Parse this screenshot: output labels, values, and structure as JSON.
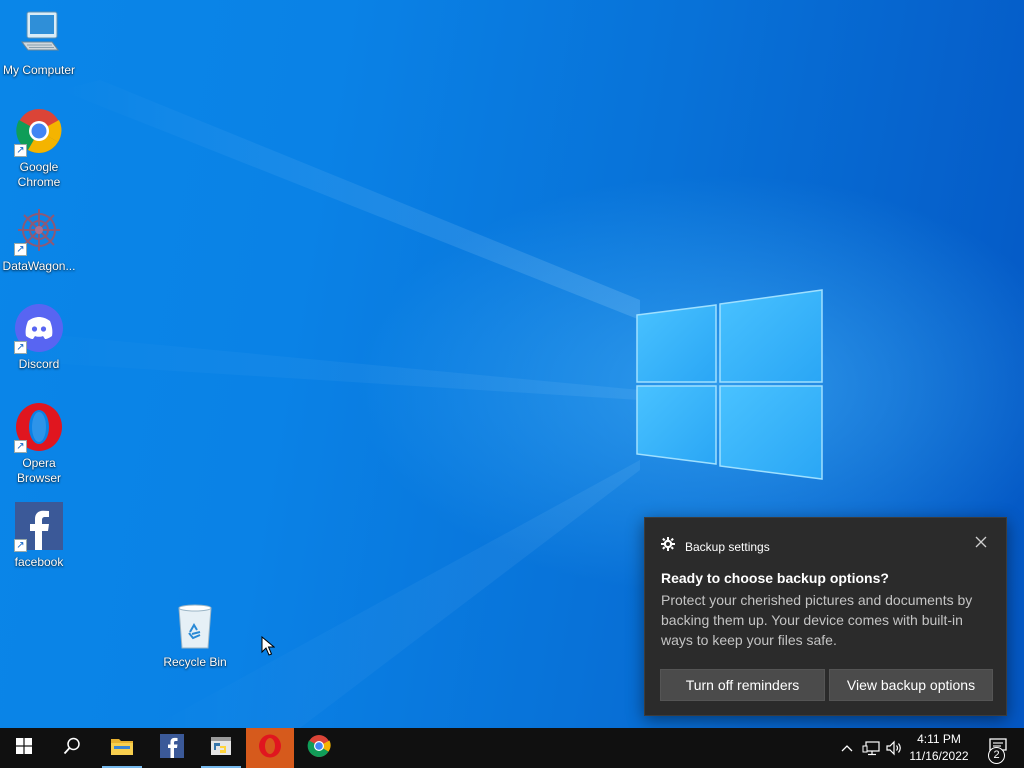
{
  "desktop": {
    "icons": [
      {
        "id": "my-computer",
        "label": "My Computer",
        "icon": "computer-icon",
        "shortcut": false
      },
      {
        "id": "google-chrome",
        "label": "Google Chrome",
        "icon": "chrome-icon",
        "shortcut": true
      },
      {
        "id": "datawagon",
        "label": "DataWagon...",
        "icon": "datawagon-icon",
        "shortcut": true
      },
      {
        "id": "discord",
        "label": "Discord",
        "icon": "discord-icon",
        "shortcut": true
      },
      {
        "id": "opera-browser",
        "label": "Opera Browser",
        "icon": "opera-icon",
        "shortcut": true
      },
      {
        "id": "facebook",
        "label": "facebook",
        "icon": "facebook-icon",
        "shortcut": true
      },
      {
        "id": "recycle-bin",
        "label": "Recycle Bin",
        "icon": "recycle-bin-icon",
        "shortcut": false
      }
    ]
  },
  "notification": {
    "app_name": "Backup settings",
    "title": "Ready to choose backup options?",
    "body": "Protect your cherished pictures and documents by backing them up. Your device comes with built-in ways to keep your files safe.",
    "buttons": {
      "dismiss": "Turn off reminders",
      "primary": "View backup options"
    }
  },
  "taskbar": {
    "pinned": [
      {
        "id": "start",
        "icon": "windows-logo-icon"
      },
      {
        "id": "search",
        "icon": "search-icon"
      },
      {
        "id": "file-explorer",
        "icon": "folder-icon"
      },
      {
        "id": "facebook",
        "icon": "facebook-icon"
      },
      {
        "id": "python-idle",
        "icon": "python-idle-icon"
      },
      {
        "id": "opera",
        "icon": "opera-icon"
      },
      {
        "id": "chrome",
        "icon": "chrome-icon"
      }
    ],
    "tray": {
      "icons": [
        "chevron-up-icon",
        "network-icon",
        "volume-icon"
      ],
      "time": "4:11 PM",
      "date": "11/16/2022",
      "notification_count": "2"
    }
  },
  "colors": {
    "taskbar_bg": "#101010",
    "toast_bg": "#2b2b2b",
    "toast_button_bg": "#4b4b4b",
    "desktop_blue": "#0a82e6",
    "opera_active": "#d65a1c"
  }
}
